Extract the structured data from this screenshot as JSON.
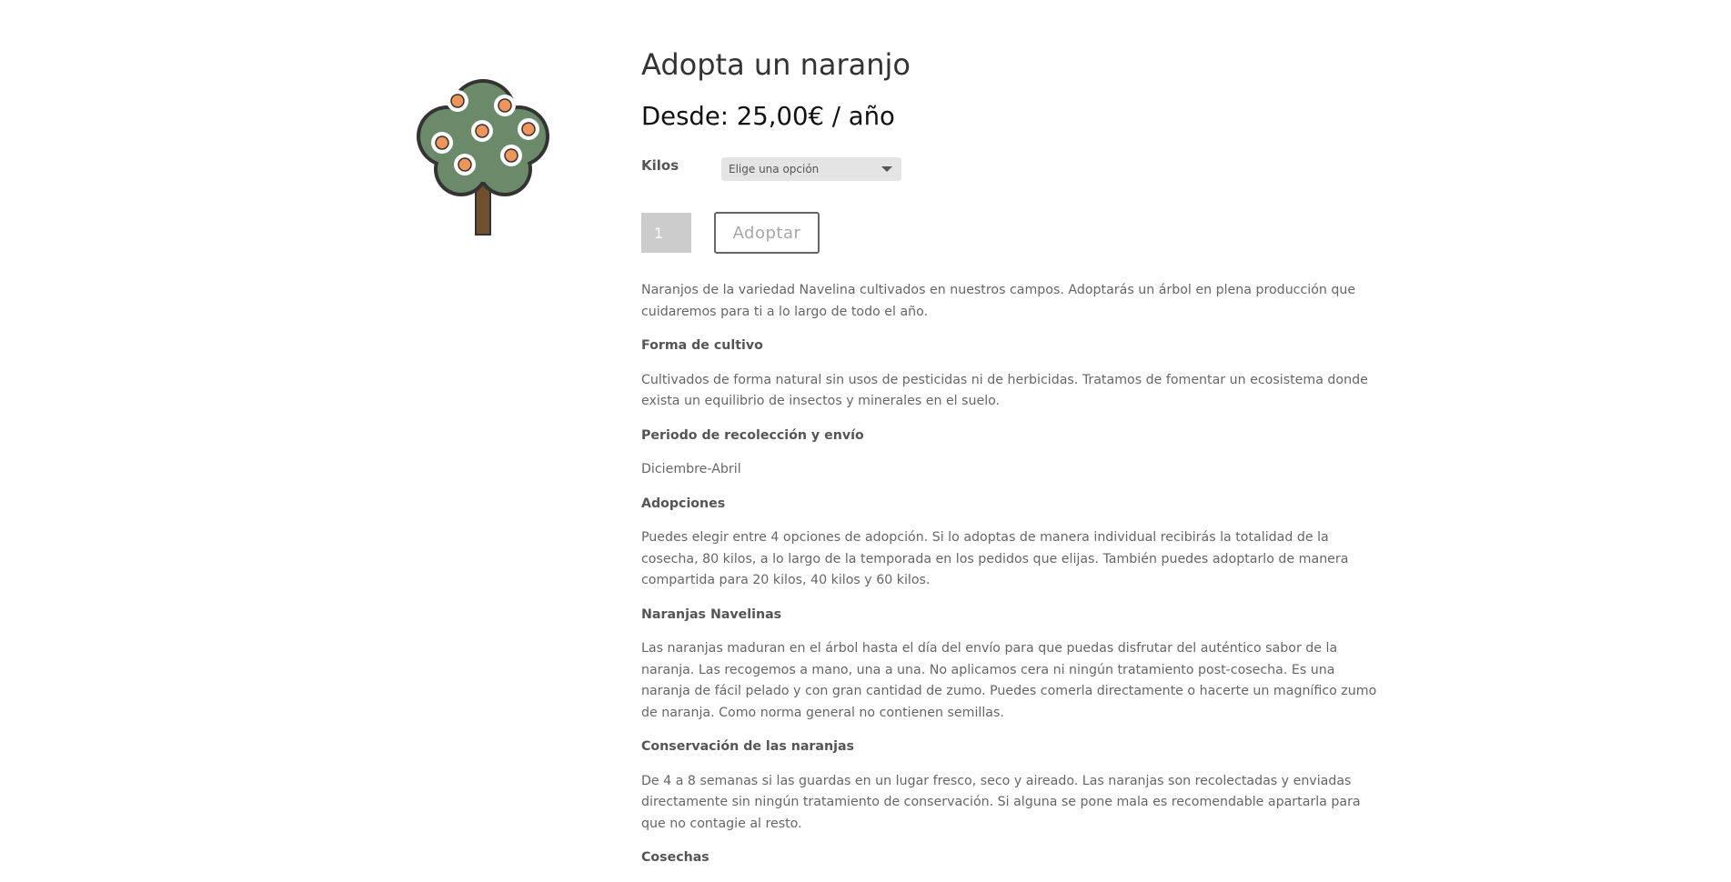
{
  "product": {
    "image_icon": "orange-tree-icon",
    "title": "Adopta un naranjo",
    "price": "Desde: 25,00€ / año",
    "variation": {
      "label": "Kilos",
      "selected": "Elige una opción"
    },
    "quantity": "1",
    "add_button": "Adoptar"
  },
  "description": {
    "intro": "Naranjos de la variedad Navelina cultivados en nuestros campos. Adoptarás un árbol en plena producción que cuidaremos para ti a lo largo de todo el año.",
    "sections": [
      {
        "heading": "Forma de cultivo",
        "text": "Cultivados de forma natural sin usos de pesticidas ni de herbicidas. Tratamos de fomentar un ecosistema donde exista un equilibrio de insectos y minerales en el suelo."
      },
      {
        "heading": "Periodo de recolección y envío",
        "text": "Diciembre-Abril"
      },
      {
        "heading": "Adopciones",
        "text": "Puedes elegir entre 4 opciones de adopción. Si lo adoptas de manera individual recibirás la totalidad de la cosecha, 80 kilos, a lo largo de la temporada en los pedidos que elijas. También puedes adoptarlo de manera compartida para 20 kilos, 40 kilos y 60 kilos."
      },
      {
        "heading": "Naranjas Navelinas",
        "text": "Las naranjas maduran en el árbol hasta el día del envío para que puedas disfrutar del auténtico sabor de la naranja. Las recogemos a mano, una a una. No aplicamos cera ni ningún tratamiento post-cosecha. Es una naranja de fácil pelado y con gran cantidad de zumo. Puedes comerla directamente o hacerte un magnífico zumo de naranja. Como norma general no contienen semillas."
      },
      {
        "heading": "Conservación de las naranjas",
        "text": "De 4 a 8 semanas si las guardas en un lugar fresco, seco y aireado. Las naranjas son recolectadas y enviadas directamente sin ningún tratamiento de conservación. Si alguna se pone mala es recomendable apartarla para que no contagie al resto."
      },
      {
        "heading": "Cosechas",
        "text": ""
      }
    ]
  },
  "colors": {
    "foliage": "#6a8a6a",
    "outline": "#333333",
    "trunk": "#6e4f2e",
    "fruit": "#f0955a"
  }
}
